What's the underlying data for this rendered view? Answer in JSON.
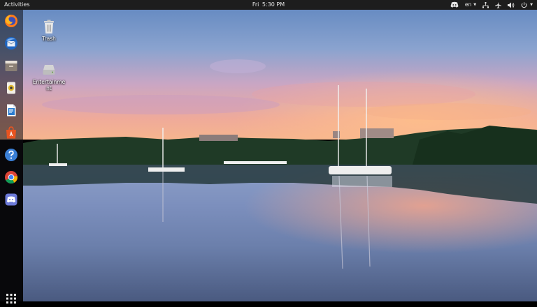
{
  "topbar": {
    "activities_label": "Activities",
    "clock_day": "Fri",
    "clock_time": "5:30 PM",
    "language": "en",
    "tray_icons": [
      "discord-icon",
      "network-icon",
      "airplane-mode-icon",
      "volume-icon",
      "power-icon"
    ]
  },
  "dock": {
    "apps": [
      {
        "name": "Firefox",
        "icon": "firefox-icon"
      },
      {
        "name": "Thunderbird",
        "icon": "thunderbird-icon"
      },
      {
        "name": "Files",
        "icon": "files-icon"
      },
      {
        "name": "Rhythmbox",
        "icon": "rhythmbox-icon"
      },
      {
        "name": "LibreOffice Writer",
        "icon": "libreoffice-writer-icon"
      },
      {
        "name": "Ubuntu Software",
        "icon": "ubuntu-software-icon"
      },
      {
        "name": "Help",
        "icon": "help-icon"
      },
      {
        "name": "Chrome",
        "icon": "chrome-icon"
      },
      {
        "name": "Discord",
        "icon": "discord-icon"
      }
    ],
    "show_apps_icon": "app-grid-icon"
  },
  "desktop": {
    "icons": [
      {
        "label": "Trash",
        "icon": "trash-icon"
      },
      {
        "label": "Entertainment",
        "icon": "drive-icon"
      }
    ]
  },
  "colors": {
    "topbar_bg": "#1d1d1d",
    "sky_top": "#6f8fbf",
    "sky_horizon": "#f0a48a",
    "water": "#5c6f96"
  }
}
